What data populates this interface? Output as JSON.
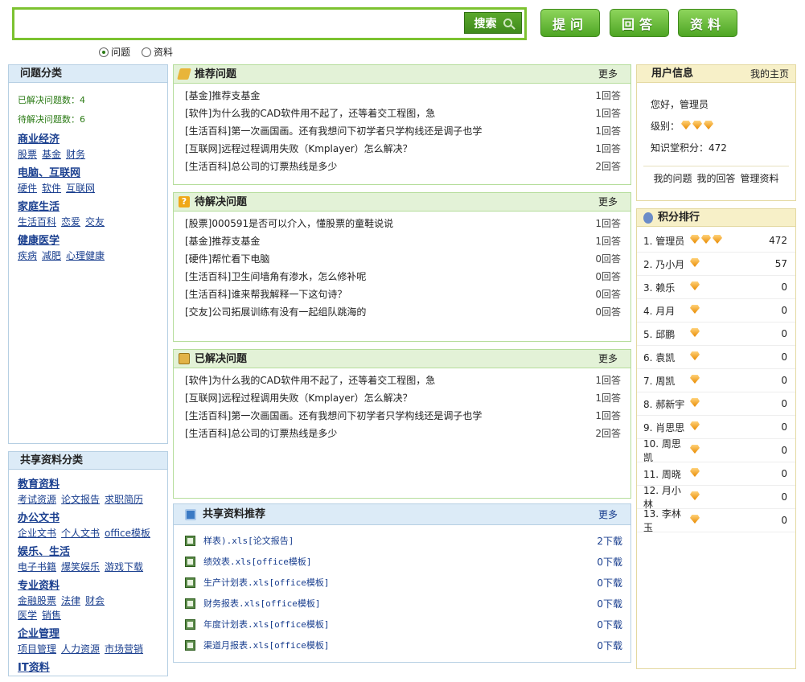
{
  "search": {
    "placeholder": "",
    "button": "搜索",
    "radio_question": "问题",
    "radio_material": "资料"
  },
  "top_buttons": {
    "ask": "提问",
    "answer": "回答",
    "material": "资料"
  },
  "categories": {
    "title": "问题分类",
    "unsolved": "已解决问题数：4",
    "pending": "待解决问题数：6",
    "groups": [
      {
        "title": "商业经济",
        "links": [
          "股票",
          "基金",
          "财务"
        ]
      },
      {
        "title": "电脑、互联网",
        "links": [
          "硬件",
          "软件",
          "互联网"
        ]
      },
      {
        "title": "家庭生活",
        "links": [
          "生活百科",
          "恋爱",
          "交友"
        ]
      },
      {
        "title": "健康医学",
        "links": [
          "疾病",
          "减肥",
          "心理健康"
        ]
      }
    ]
  },
  "shared_categories": {
    "title": "共享资料分类",
    "groups": [
      {
        "title": "教育资料",
        "rows": [
          [
            "考试资源",
            "论文报告",
            "求职简历"
          ]
        ]
      },
      {
        "title": "办公文书",
        "rows": [
          [
            "企业文书",
            "个人文书",
            "office模板"
          ]
        ]
      },
      {
        "title": "娱乐、生活",
        "rows": [
          [
            "电子书籍",
            "爆笑娱乐",
            "游戏下载"
          ]
        ]
      },
      {
        "title": "专业资料",
        "rows": [
          [
            "金融股票",
            "法律",
            "财会"
          ],
          [
            "医学",
            "销售"
          ]
        ]
      },
      {
        "title": "企业管理",
        "rows": [
          [
            "项目管理",
            "人力资源",
            "市场营销"
          ]
        ]
      },
      {
        "title": "IT资料",
        "rows": []
      }
    ]
  },
  "recommended": {
    "title": "推荐问题",
    "more": "更多",
    "items": [
      {
        "q": "[基金]推荐支基金",
        "a": "1回答"
      },
      {
        "q": "[软件]为什么我的CAD软件用不起了，还等着交工程图，急",
        "a": "1回答"
      },
      {
        "q": "[生活百科]第一次画国画。还有我想问下初学者只学构线还是调子也学",
        "a": "1回答"
      },
      {
        "q": "[互联网]远程过程调用失败（Kmplayer）怎么解决？",
        "a": "1回答"
      },
      {
        "q": "[生活百科]总公司的订票热线是多少",
        "a": "2回答"
      }
    ]
  },
  "pending": {
    "title": "待解决问题",
    "more": "更多",
    "items": [
      {
        "q": "[股票]000591是否可以介入，懂股票的童鞋说说",
        "a": "1回答"
      },
      {
        "q": "[基金]推荐支基金",
        "a": "1回答"
      },
      {
        "q": "[硬件]帮忙看下电脑",
        "a": "0回答"
      },
      {
        "q": "[生活百科]卫生间墙角有渗水，怎么修补呢",
        "a": "0回答"
      },
      {
        "q": "[生活百科]谁来帮我解释一下这句诗？",
        "a": "0回答"
      },
      {
        "q": "[交友]公司拓展训练有没有一起组队跳海的",
        "a": "0回答"
      }
    ]
  },
  "solved": {
    "title": "已解决问题",
    "more": "更多",
    "items": [
      {
        "q": "[软件]为什么我的CAD软件用不起了，还等着交工程图，急",
        "a": "1回答"
      },
      {
        "q": "[互联网]远程过程调用失败（Kmplayer）怎么解决？",
        "a": "1回答"
      },
      {
        "q": "[生活百科]第一次画国画。还有我想问下初学者只学构线还是调子也学",
        "a": "1回答"
      },
      {
        "q": "[生活百科]总公司的订票热线是多少",
        "a": "2回答"
      }
    ]
  },
  "shared": {
    "title": "共享资料推荐",
    "more": "更多",
    "items": [
      {
        "name": "样表).xls[论文报告]",
        "dl": "2下载"
      },
      {
        "name": "绩效表.xls[office模板]",
        "dl": "0下载"
      },
      {
        "name": "生产计划表.xls[office模板]",
        "dl": "0下载"
      },
      {
        "name": "财务报表.xls[office模板]",
        "dl": "0下载"
      },
      {
        "name": "年度计划表.xls[office模板]",
        "dl": "0下载"
      },
      {
        "name": "渠道月报表.xls[office模板]",
        "dl": "0下载"
      }
    ]
  },
  "user": {
    "title": "用户信息",
    "home": "我的主页",
    "greeting": "您好，管理员",
    "level_label": "级别：",
    "level_gems": 3,
    "points": "知识堂积分：472",
    "links": [
      "我的问题",
      "我的回答",
      "管理资料"
    ]
  },
  "ranking": {
    "title": "积分排行",
    "rows": [
      {
        "n": "1. 管理员",
        "gems": 3,
        "p": "472"
      },
      {
        "n": "2. 乃小月",
        "gems": 1,
        "p": "57"
      },
      {
        "n": "3. 赖乐",
        "gems": 1,
        "p": "0"
      },
      {
        "n": "4. 月月",
        "gems": 1,
        "p": "0"
      },
      {
        "n": "5. 邱鹏",
        "gems": 1,
        "p": "0"
      },
      {
        "n": "6. 袁凯",
        "gems": 1,
        "p": "0"
      },
      {
        "n": "7. 周凯",
        "gems": 1,
        "p": "0"
      },
      {
        "n": "8. 郝新宇",
        "gems": 1,
        "p": "0"
      },
      {
        "n": "9. 肖思思",
        "gems": 1,
        "p": "0"
      },
      {
        "n": "10. 周思凯",
        "gems": 1,
        "p": "0"
      },
      {
        "n": "11. 周晓",
        "gems": 1,
        "p": "0"
      },
      {
        "n": "12. 月小林",
        "gems": 1,
        "p": "0"
      },
      {
        "n": "13. 李林玉",
        "gems": 1,
        "p": "0"
      }
    ]
  },
  "colors": {
    "green": "#7cc230",
    "blue_panel": "#dcebf7",
    "green_panel": "#e3f2d7",
    "yellow_panel": "#f7f0c8",
    "gem": "#f29a1a"
  }
}
